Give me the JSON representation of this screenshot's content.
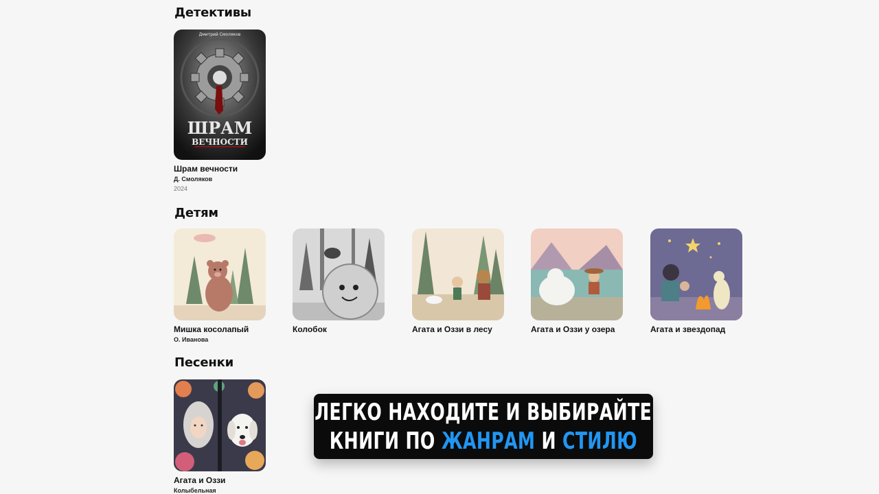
{
  "sections": {
    "detectives": {
      "title": "Детективы",
      "books": [
        {
          "title": "Шрам вечности",
          "author": "Д. Смоляков",
          "year": "2024",
          "cover_author": "Дмитрий Смоляков",
          "cover_title_1": "ШРАМ",
          "cover_title_2": "ВЕЧНОСТИ"
        }
      ]
    },
    "kids": {
      "title": "Детям",
      "books": [
        {
          "title": "Мишка косолапый",
          "author": "О. Иванова"
        },
        {
          "title": "Колобок"
        },
        {
          "title": "Агата и Оззи в лесу"
        },
        {
          "title": "Агата и Оззи у озера"
        },
        {
          "title": "Агата и звездопад"
        }
      ]
    },
    "songs": {
      "title": "Песенки",
      "books": [
        {
          "title": "Агата и Оззи",
          "author": "Колыбельная"
        }
      ]
    }
  },
  "banner": {
    "line1": "ЛЕГКО НАХОДИТЕ И ВЫБИРАЙТЕ",
    "line2_part1": "КНИГИ ПО",
    "line2_accent1": "ЖАНРАМ",
    "line2_part2": "И",
    "line2_accent2": "СТИЛЮ",
    "accent_color": "#2196f3"
  }
}
